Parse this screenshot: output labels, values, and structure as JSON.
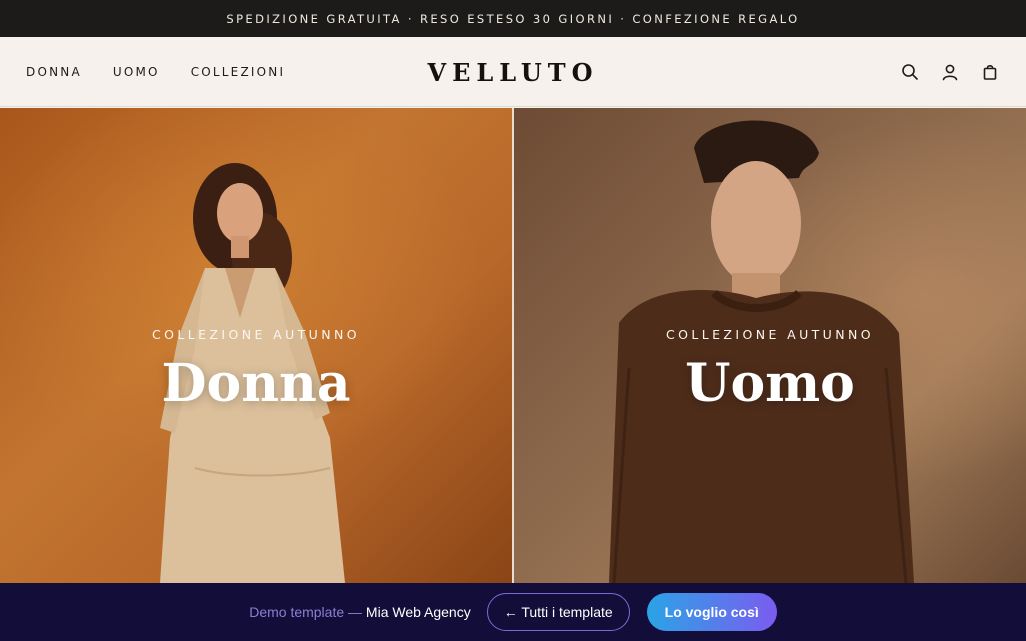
{
  "announcement": "SPEDIZIONE GRATUITA · RESO ESTESO 30 GIORNI · CONFEZIONE REGALO",
  "header": {
    "nav": [
      "DONNA",
      "UOMO",
      "COLLEZIONI"
    ],
    "logo": "VELLUTO",
    "icons": [
      "search-icon",
      "account-icon",
      "bag-icon"
    ]
  },
  "hero": {
    "left": {
      "kicker": "COLLEZIONE AUTUNNO",
      "title": "Donna"
    },
    "right": {
      "kicker": "COLLEZIONE AUTUNNO",
      "title": "Uomo"
    }
  },
  "demo_bar": {
    "prefix": "Demo template — ",
    "agency": "Mia Web Agency",
    "all_templates": "← Tutti i template",
    "cta": "Lo voglio così"
  },
  "colors": {
    "topbar_bg": "#1d1b19",
    "header_bg": "#f6f1ec",
    "demo_bg": "#130d3a",
    "cta_gradient_start": "#2ba3e6",
    "cta_gradient_end": "#7b5cf0"
  }
}
